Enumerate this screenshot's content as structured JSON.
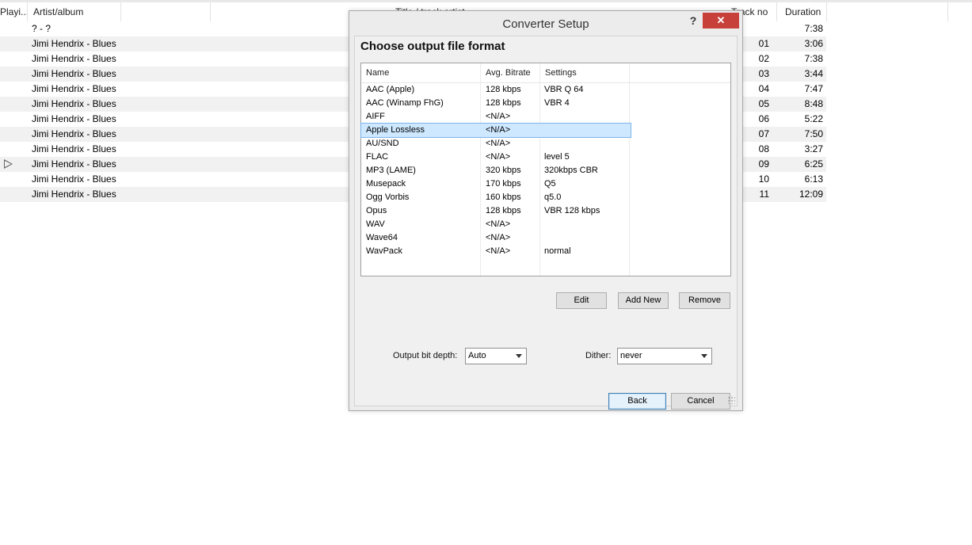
{
  "playlist": {
    "columns": [
      "Playi...",
      "Artist/album",
      "Title / track artist",
      "Track no",
      "Duration"
    ],
    "rows": [
      {
        "artist": "? - ?",
        "track": "",
        "duration": "7:38",
        "playing": false
      },
      {
        "artist": "Jimi Hendrix - Blues",
        "track": "01",
        "duration": "3:06",
        "playing": false
      },
      {
        "artist": "Jimi Hendrix - Blues",
        "track": "02",
        "duration": "7:38",
        "playing": false
      },
      {
        "artist": "Jimi Hendrix - Blues",
        "track": "03",
        "duration": "3:44",
        "playing": false
      },
      {
        "artist": "Jimi Hendrix - Blues",
        "track": "04",
        "duration": "7:47",
        "playing": false
      },
      {
        "artist": "Jimi Hendrix - Blues",
        "track": "05",
        "duration": "8:48",
        "playing": false
      },
      {
        "artist": "Jimi Hendrix - Blues",
        "track": "06",
        "duration": "5:22",
        "playing": false
      },
      {
        "artist": "Jimi Hendrix - Blues",
        "track": "07",
        "duration": "7:50",
        "playing": false
      },
      {
        "artist": "Jimi Hendrix - Blues",
        "track": "08",
        "duration": "3:27",
        "playing": false
      },
      {
        "artist": "Jimi Hendrix - Blues",
        "track": "09",
        "duration": "6:25",
        "playing": true
      },
      {
        "artist": "Jimi Hendrix - Blues",
        "track": "10",
        "duration": "6:13",
        "playing": false
      },
      {
        "artist": "Jimi Hendrix - Blues",
        "track": "11",
        "duration": "12:09",
        "playing": false
      }
    ]
  },
  "dialog": {
    "title": "Converter Setup",
    "help_label": "?",
    "close_label": "✕",
    "heading": "Choose output file format",
    "table": {
      "headers": [
        "Name",
        "Avg. Bitrate",
        "Settings"
      ],
      "selected_index": 3,
      "rows": [
        [
          "AAC (Apple)",
          "128 kbps",
          "VBR Q 64"
        ],
        [
          "AAC (Winamp FhG)",
          "128 kbps",
          "VBR 4"
        ],
        [
          "AIFF",
          "<N/A>",
          ""
        ],
        [
          "Apple Lossless",
          "<N/A>",
          ""
        ],
        [
          "AU/SND",
          "<N/A>",
          ""
        ],
        [
          "FLAC",
          "<N/A>",
          "level 5"
        ],
        [
          "MP3 (LAME)",
          "320 kbps",
          "320kbps CBR"
        ],
        [
          "Musepack",
          "170 kbps",
          "Q5"
        ],
        [
          "Ogg Vorbis",
          "160 kbps",
          "q5.0"
        ],
        [
          "Opus",
          "128 kbps",
          "VBR 128 kbps"
        ],
        [
          "WAV",
          "<N/A>",
          ""
        ],
        [
          "Wave64",
          "<N/A>",
          ""
        ],
        [
          "WavPack",
          "<N/A>",
          "normal"
        ]
      ]
    },
    "buttons": {
      "edit": "Edit",
      "add_new": "Add New",
      "remove": "Remove",
      "back": "Back",
      "cancel": "Cancel"
    },
    "output_bit_depth": {
      "label": "Output bit depth:",
      "value": "Auto"
    },
    "dither": {
      "label": "Dither:",
      "value": "never"
    }
  },
  "colors": {
    "close_button": "#c7413a",
    "selection": "#cde8ff",
    "alt_row": "#f1f1f1"
  }
}
